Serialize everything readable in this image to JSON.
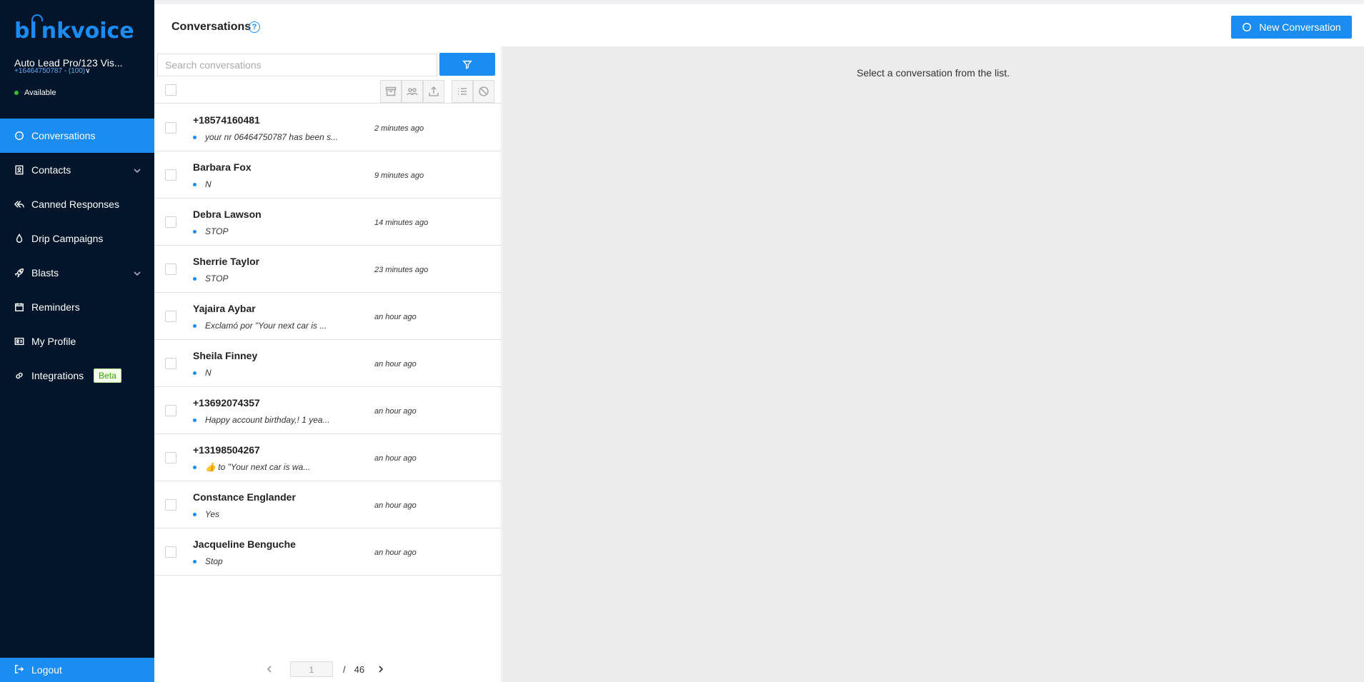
{
  "sidebar": {
    "logo": "bl nkvoice",
    "account_name": "Auto Lead Pro/123 Vis...",
    "account_phone": "+16464750787 - (100)",
    "status": "Available",
    "items": [
      {
        "label": "Conversations",
        "icon": "chat-icon",
        "active": true
      },
      {
        "label": "Contacts",
        "icon": "contact-card-icon",
        "expandable": true
      },
      {
        "label": "Canned Responses",
        "icon": "reply-all-icon"
      },
      {
        "label": "Drip Campaigns",
        "icon": "drop-icon"
      },
      {
        "label": "Blasts",
        "icon": "rocket-icon",
        "expandable": true
      },
      {
        "label": "Reminders",
        "icon": "calendar-icon"
      },
      {
        "label": "My Profile",
        "icon": "id-card-icon"
      },
      {
        "label": "Integrations",
        "icon": "link-icon",
        "badge": "Beta"
      }
    ],
    "logout": "Logout",
    "colors": {
      "background": "#03152b",
      "accent": "#1b8cf2"
    }
  },
  "header": {
    "title": "Conversations",
    "help": "?",
    "new_button": "New Conversation"
  },
  "list": {
    "search_placeholder": "Search conversations",
    "toolbar_icons": [
      "archive-icon",
      "group-icon",
      "export-icon",
      "list-icon",
      "block-icon"
    ],
    "rows": [
      {
        "name": "+18574160481",
        "preview": "your nr 06464750787 has been s...",
        "time": "2 minutes ago"
      },
      {
        "name": "Barbara Fox",
        "preview": "N",
        "time": "9 minutes ago"
      },
      {
        "name": "Debra Lawson",
        "preview": "STOP",
        "time": "14 minutes ago"
      },
      {
        "name": "Sherrie Taylor",
        "preview": "STOP",
        "time": "23 minutes ago"
      },
      {
        "name": "Yajaira Aybar",
        "preview": "Exclamó por \"Your next car is ...",
        "time": "an hour ago"
      },
      {
        "name": "Sheila Finney",
        "preview": "N",
        "time": "an hour ago"
      },
      {
        "name": "+13692074357",
        "preview": "Happy account birthday,! 1 yea...",
        "time": "an hour ago"
      },
      {
        "name": "+13198504267",
        "preview": "👍 to \"Your next car is wa...",
        "time": "an hour ago"
      },
      {
        "name": "Constance Englander",
        "preview": "Yes",
        "time": "an hour ago"
      },
      {
        "name": "Jacqueline Benguche",
        "preview": "Stop",
        "time": "an hour ago"
      }
    ],
    "pagination": {
      "current": "1",
      "separator": "/",
      "total": "46"
    }
  },
  "detail": {
    "empty_message": "Select a conversation from the list."
  }
}
